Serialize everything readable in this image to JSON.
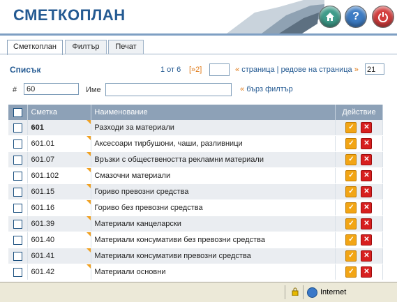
{
  "header": {
    "title": "СМЕТКОПЛАН"
  },
  "tabs": [
    {
      "label": "Сметкоплан",
      "active": true
    },
    {
      "label": "Филтър",
      "active": false
    },
    {
      "label": "Печат",
      "active": false
    }
  ],
  "list": {
    "title": "Списък",
    "page_info": "1 от 6",
    "next": "[»2]",
    "page_value": "",
    "page_label_prefix": "«",
    "page_label": "страница | редове на страница",
    "page_label_suffix": "»",
    "rows_per_page": "21"
  },
  "filter": {
    "number_label": "#",
    "number_value": "60",
    "name_label": "Име",
    "name_value": "",
    "quick_prefix": "«",
    "quick_label": "бърз филтър"
  },
  "table": {
    "headers": {
      "account": "Сметка",
      "name": "Наименование",
      "action": "Действие"
    },
    "rows": [
      {
        "account": "601",
        "name": "Разходи за материали",
        "bold": true
      },
      {
        "account": "601.01",
        "name": "Аксесоари тирбушони, чаши, разливници"
      },
      {
        "account": "601.07",
        "name": "Връзки с обществеността рекламни материали"
      },
      {
        "account": "601.102",
        "name": "Смазочни материали"
      },
      {
        "account": "601.15",
        "name": "Гориво превозни средства"
      },
      {
        "account": "601.16",
        "name": "Гориво без превозни средства"
      },
      {
        "account": "601.39",
        "name": "Материали канцеларски"
      },
      {
        "account": "601.40",
        "name": "Материали консумативи без превозни средства"
      },
      {
        "account": "601.41",
        "name": "Материали консумативи превозни средства"
      },
      {
        "account": "601.42",
        "name": "Материали основни"
      }
    ]
  },
  "statusbar": {
    "zone": "Internet"
  },
  "colors": {
    "accent": "#245a92",
    "header_row": "#8da1b7",
    "orange": "#e07b1a"
  }
}
